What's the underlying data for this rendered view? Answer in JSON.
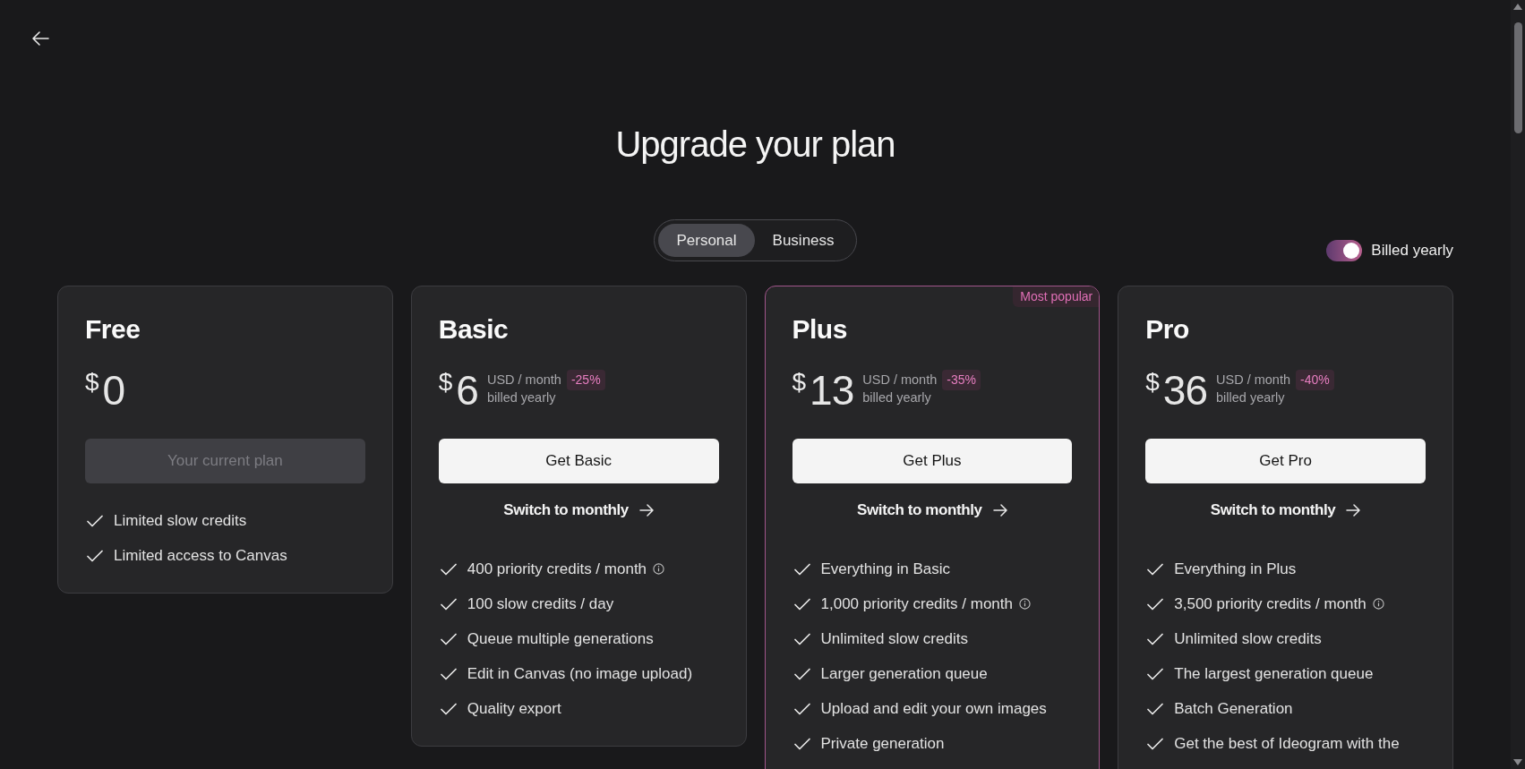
{
  "title": "Upgrade your plan",
  "plan_type_tabs": [
    {
      "label": "Personal",
      "selected": true
    },
    {
      "label": "Business",
      "selected": false
    }
  ],
  "billing_toggle": {
    "label": "Billed yearly",
    "on": true
  },
  "plans": [
    {
      "name": "Free",
      "featured": false,
      "currency": "$",
      "price": "0",
      "button": {
        "label": "Your current plan",
        "disabled": true
      },
      "features": [
        {
          "text": "Limited slow credits",
          "info": false
        },
        {
          "text": "Limited access to Canvas",
          "info": false
        }
      ]
    },
    {
      "name": "Basic",
      "featured": false,
      "currency": "$",
      "price": "6",
      "unit": "USD / month",
      "discount": "-25%",
      "billing": "billed yearly",
      "button": {
        "label": "Get Basic",
        "disabled": false
      },
      "switch_link": "Switch to monthly",
      "features": [
        {
          "text": "400 priority credits / month",
          "info": true
        },
        {
          "text": "100 slow credits / day",
          "info": false
        },
        {
          "text": "Queue multiple generations",
          "info": false
        },
        {
          "text": "Edit in Canvas (no image upload)",
          "info": false
        },
        {
          "text": "Quality export",
          "info": false
        }
      ]
    },
    {
      "name": "Plus",
      "featured": true,
      "badge": "Most popular",
      "currency": "$",
      "price": "13",
      "unit": "USD / month",
      "discount": "-35%",
      "billing": "billed yearly",
      "button": {
        "label": "Get Plus",
        "disabled": false
      },
      "switch_link": "Switch to monthly",
      "features": [
        {
          "text": "Everything in Basic",
          "info": false
        },
        {
          "text": "1,000 priority credits / month",
          "info": true
        },
        {
          "text": "Unlimited slow credits",
          "info": false
        },
        {
          "text": "Larger generation queue",
          "info": false
        },
        {
          "text": "Upload and edit your own images",
          "info": false
        },
        {
          "text": "Private generation",
          "info": false
        }
      ]
    },
    {
      "name": "Pro",
      "featured": false,
      "currency": "$",
      "price": "36",
      "unit": "USD / month",
      "discount": "-40%",
      "billing": "billed yearly",
      "button": {
        "label": "Get Pro",
        "disabled": false
      },
      "switch_link": "Switch to monthly",
      "features": [
        {
          "text": "Everything in Plus",
          "info": false
        },
        {
          "text": "3,500 priority credits / month",
          "info": true
        },
        {
          "text": "Unlimited slow credits",
          "info": false
        },
        {
          "text": "The largest generation queue",
          "info": false
        },
        {
          "text": "Batch Generation",
          "info": false
        },
        {
          "text": "Get the best of Ideogram with the",
          "info": false
        }
      ]
    }
  ]
}
